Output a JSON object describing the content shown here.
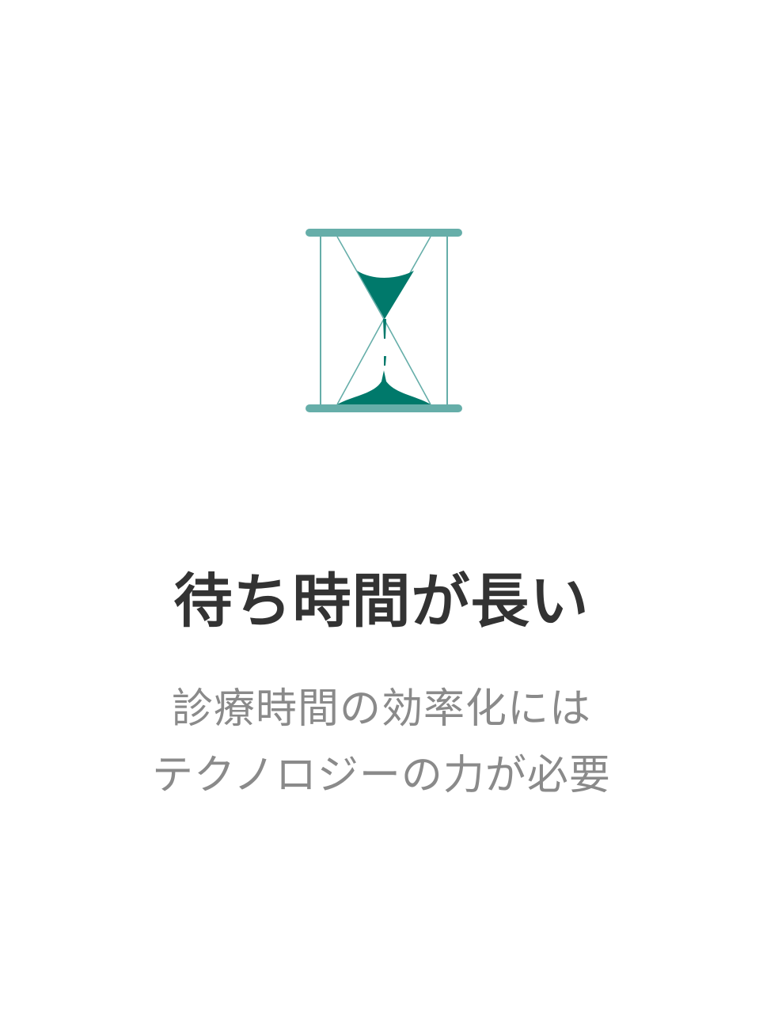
{
  "screen": {
    "illustration_icon": "hourglass-icon",
    "title": "待ち時間が長い",
    "description_lines": [
      "診療時間の効率化には",
      "テクノロジーの力が必要"
    ]
  },
  "colors": {
    "background": "#ffffff",
    "hourglass_frame": "#66aea9",
    "hourglass_sand": "#00796b",
    "title_text": "#333333",
    "description_text": "#8a8a8a"
  }
}
